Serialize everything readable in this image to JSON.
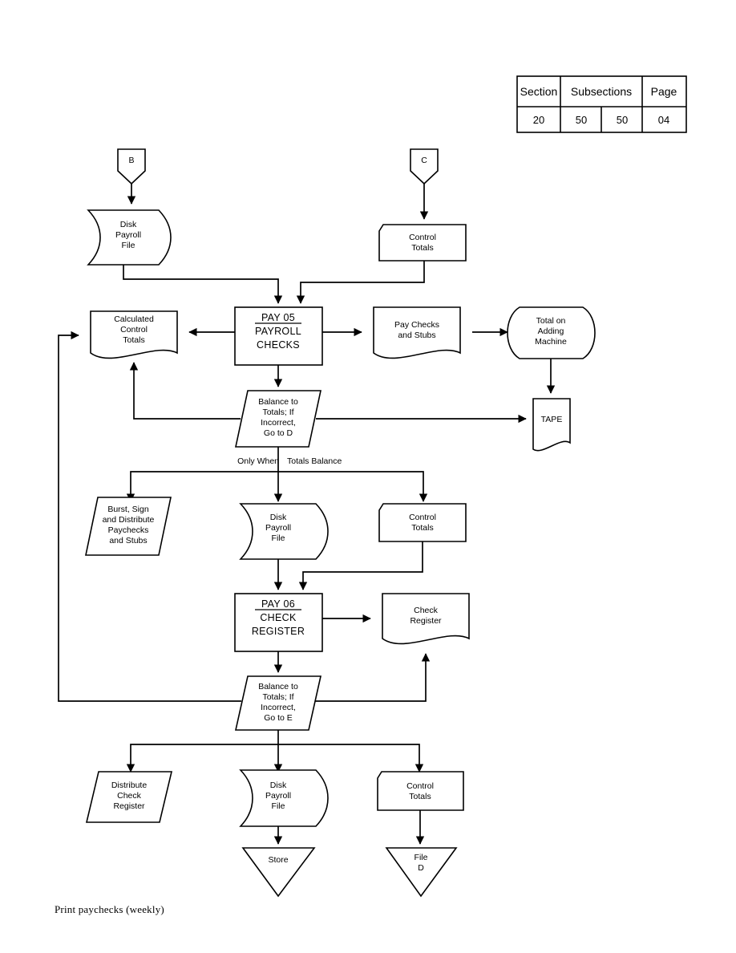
{
  "document": {
    "caption": "Print paychecks (weekly)"
  },
  "header_table": {
    "columns": [
      {
        "label": "Section",
        "value": "20"
      },
      {
        "label": "Subsections",
        "value_left": "50",
        "value_right": "50"
      },
      {
        "label": "Page",
        "value": "04"
      }
    ],
    "section_label": "Section",
    "section_value": "20",
    "subsections_label": "Subsections",
    "subsections_value_left": "50",
    "subsections_value_right": "50",
    "page_label": "Page",
    "page_value": "04"
  },
  "chart_data": {
    "type": "diagram",
    "title": "Print paychecks (weekly)",
    "diagram_kind": "flowchart",
    "nodes": [
      {
        "id": "conn-b",
        "shape": "connector-pentagon",
        "lines": [
          "B"
        ]
      },
      {
        "id": "conn-c",
        "shape": "connector-pentagon",
        "lines": [
          "C"
        ]
      },
      {
        "id": "disk-payroll-1",
        "shape": "drum",
        "lines": [
          "Disk",
          "Payroll",
          "File"
        ]
      },
      {
        "id": "control-totals-1",
        "shape": "document",
        "lines": [
          "Control",
          "Totals"
        ]
      },
      {
        "id": "calculated-control-totals",
        "shape": "document",
        "lines": [
          "Calculated",
          "Control",
          "Totals"
        ]
      },
      {
        "id": "pay05",
        "shape": "process",
        "lines": [
          "PAY 05",
          "PAYROLL",
          "CHECKS"
        ],
        "underline_first": true
      },
      {
        "id": "pay-checks-stubs",
        "shape": "document",
        "lines": [
          "Pay Checks",
          "and Stubs"
        ]
      },
      {
        "id": "total-adding-machine",
        "shape": "display",
        "lines": [
          "Total on",
          "Adding",
          "Machine"
        ]
      },
      {
        "id": "balance-d",
        "shape": "parallelogram",
        "lines": [
          "Balance to",
          "Totals; If",
          "Incorrect,",
          "Go to D"
        ]
      },
      {
        "id": "tape",
        "shape": "document",
        "lines": [
          "TAPE"
        ]
      },
      {
        "id": "burst-sign",
        "shape": "parallelogram",
        "lines": [
          "Burst, Sign",
          "and Distribute",
          "Paychecks",
          "and Stubs"
        ]
      },
      {
        "id": "disk-payroll-2",
        "shape": "drum",
        "lines": [
          "Disk",
          "Payroll",
          "File"
        ]
      },
      {
        "id": "control-totals-2",
        "shape": "document",
        "lines": [
          "Control",
          "Totals"
        ]
      },
      {
        "id": "pay06",
        "shape": "process",
        "lines": [
          "PAY 06",
          "CHECK",
          "REGISTER"
        ],
        "underline_first": true
      },
      {
        "id": "check-register",
        "shape": "document",
        "lines": [
          "Check",
          "Register"
        ]
      },
      {
        "id": "balance-e",
        "shape": "parallelogram",
        "lines": [
          "Balance to",
          "Totals; If",
          "Incorrect,",
          "Go to E"
        ]
      },
      {
        "id": "distribute-check-register",
        "shape": "parallelogram",
        "lines": [
          "Distribute",
          "Check",
          "Register"
        ]
      },
      {
        "id": "disk-payroll-3",
        "shape": "drum",
        "lines": [
          "Disk",
          "Payroll",
          "File"
        ]
      },
      {
        "id": "control-totals-3",
        "shape": "document",
        "lines": [
          "Control",
          "Totals"
        ]
      },
      {
        "id": "store",
        "shape": "triangle",
        "lines": [
          "Store"
        ]
      },
      {
        "id": "file-d",
        "shape": "triangle",
        "lines": [
          "File",
          "D"
        ]
      }
    ],
    "edge_labels": [
      {
        "id": "only-when",
        "text": "Only When"
      },
      {
        "id": "totals-balance",
        "text": "Totals Balance"
      }
    ]
  },
  "nodes": {
    "conn_b": "B",
    "conn_c": "C",
    "disk1_l1": "Disk",
    "disk1_l2": "Payroll",
    "disk1_l3": "File",
    "ct1_l1": "Control",
    "ct1_l2": "Totals",
    "cct_l1": "Calculated",
    "cct_l2": "Control",
    "cct_l3": "Totals",
    "pay05_l1": "PAY 05",
    "pay05_l2": "PAYROLL",
    "pay05_l3": "CHECKS",
    "paychecks_l1": "Pay Checks",
    "paychecks_l2": "and Stubs",
    "total_l1": "Total on",
    "total_l2": "Adding",
    "total_l3": "Machine",
    "bal_d_l1": "Balance to",
    "bal_d_l2": "Totals; If",
    "bal_d_l3": "Incorrect,",
    "bal_d_l4": "Go to D",
    "tape": "TAPE",
    "burst_l1": "Burst, Sign",
    "burst_l2": "and Distribute",
    "burst_l3": "Paychecks",
    "burst_l4": "and Stubs",
    "disk2_l1": "Disk",
    "disk2_l2": "Payroll",
    "disk2_l3": "File",
    "ct2_l1": "Control",
    "ct2_l2": "Totals",
    "pay06_l1": "PAY 06",
    "pay06_l2": "CHECK",
    "pay06_l3": "REGISTER",
    "chkreg_l1": "Check",
    "chkreg_l2": "Register",
    "bal_e_l1": "Balance to",
    "bal_e_l2": "Totals; If",
    "bal_e_l3": "Incorrect,",
    "bal_e_l4": "Go to E",
    "distrib_l1": "Distribute",
    "distrib_l2": "Check",
    "distrib_l3": "Register",
    "disk3_l1": "Disk",
    "disk3_l2": "Payroll",
    "disk3_l3": "File",
    "ct3_l1": "Control",
    "ct3_l2": "Totals",
    "store": "Store",
    "filed_l1": "File",
    "filed_l2": "D",
    "only_when": "Only When",
    "totals_balance": "Totals Balance"
  }
}
